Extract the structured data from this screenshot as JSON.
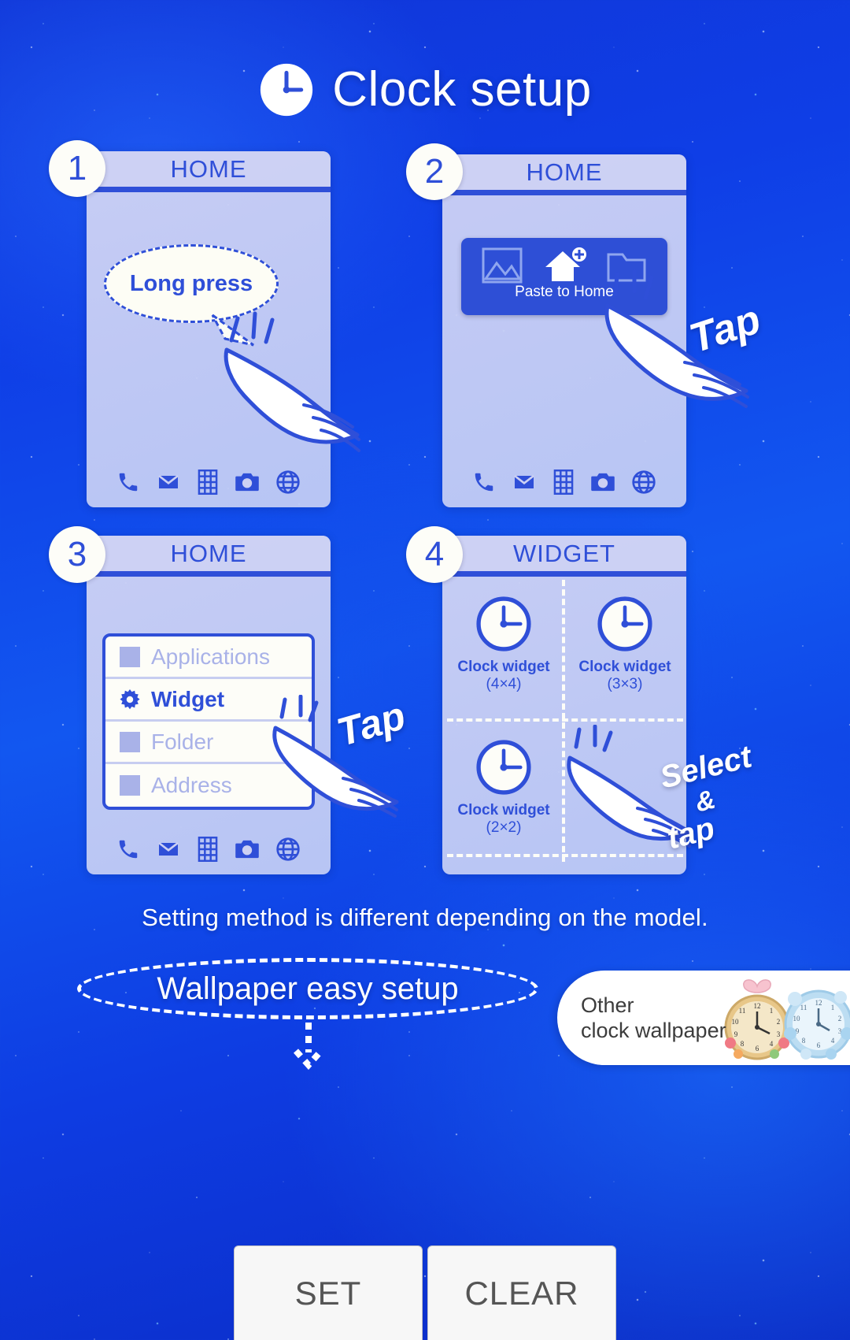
{
  "header": {
    "title": "Clock setup",
    "clock_icon": "clock-icon"
  },
  "steps": [
    {
      "number": "1",
      "screen_label": "HOME",
      "bubble_text": "Long press",
      "icon": "hand-tap-icon"
    },
    {
      "number": "2",
      "screen_label": "HOME",
      "dialog_label": "Paste to Home",
      "dialog_icons": [
        "image-icon",
        "home-plus-icon",
        "folder-icon"
      ],
      "gesture_text": "Tap"
    },
    {
      "number": "3",
      "screen_label": "HOME",
      "menu_items": [
        {
          "label": "Applications",
          "icon": "square-icon",
          "active": false
        },
        {
          "label": "Widget",
          "icon": "gear-icon",
          "active": true
        },
        {
          "label": "Folder",
          "icon": "square-icon",
          "active": false
        },
        {
          "label": "Address",
          "icon": "square-icon",
          "active": false
        }
      ],
      "gesture_text": "Tap"
    },
    {
      "number": "4",
      "screen_label": "WIDGET",
      "widgets": [
        {
          "label": "Clock widget",
          "size": "(4×4)",
          "icon": "clock-icon"
        },
        {
          "label": "Clock widget",
          "size": "(3×3)",
          "icon": "clock-icon"
        },
        {
          "label": "Clock widget",
          "size": "(2×2)",
          "icon": "clock-icon"
        }
      ],
      "gesture_text_lines": [
        "Select",
        "&",
        "tap"
      ]
    }
  ],
  "dock_icons": [
    "phone-icon",
    "mail-icon",
    "keypad-icon",
    "camera-icon",
    "browser-icon"
  ],
  "note": "Setting method is different depending on the model.",
  "cta": {
    "label": "Wallpaper easy setup"
  },
  "other_card": {
    "line1": "Other",
    "line2": "clock wallpaper"
  },
  "buttons": [
    {
      "label": "SET"
    },
    {
      "label": "CLEAR"
    }
  ],
  "colors": {
    "accent_blue": "#2f4fd8",
    "background_blue": "#0f3ee6",
    "panel_lavender": "#ccd0f3",
    "white": "#ffffff"
  }
}
